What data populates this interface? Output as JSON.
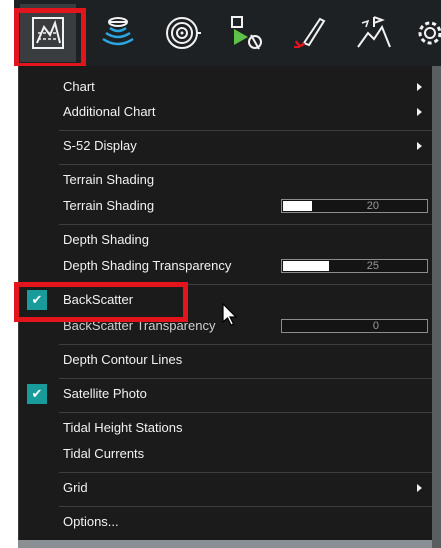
{
  "toolbar": {
    "buttons": [
      {
        "icon": "chart-layers-icon",
        "selected": true
      },
      {
        "icon": "sonar-icon"
      },
      {
        "icon": "radar-icon"
      },
      {
        "icon": "waypoint-route-icon"
      },
      {
        "icon": "fishing-rod-icon"
      },
      {
        "icon": "terrain-flag-icon"
      },
      {
        "icon": "settings-gear-icon"
      }
    ],
    "accent_color": "#e3141c"
  },
  "menu": {
    "chart": "Chart",
    "additional_chart": "Additional Chart",
    "s52_display": "S-52 Display",
    "terrain_shading": "Terrain Shading",
    "terrain_shading_slider_label": "Terrain Shading",
    "terrain_shading_value": "20",
    "terrain_shading_fraction": 0.2,
    "depth_shading": "Depth Shading",
    "depth_shading_transparency": "Depth Shading Transparency",
    "depth_shading_transparency_value": "25",
    "depth_shading_transparency_fraction": 0.32,
    "backscatter": "BackScatter",
    "backscatter_checked": true,
    "backscatter_transparency": "BackScatter Transparency",
    "backscatter_transparency_value": "0",
    "backscatter_transparency_fraction": 0.0,
    "depth_contour_lines": "Depth Contour Lines",
    "satellite_photo": "Satellite Photo",
    "satellite_photo_checked": true,
    "tidal_height_stations": "Tidal Height Stations",
    "tidal_currents": "Tidal Currents",
    "grid": "Grid",
    "options": "Options...",
    "check_color": "#1a9b9b"
  }
}
